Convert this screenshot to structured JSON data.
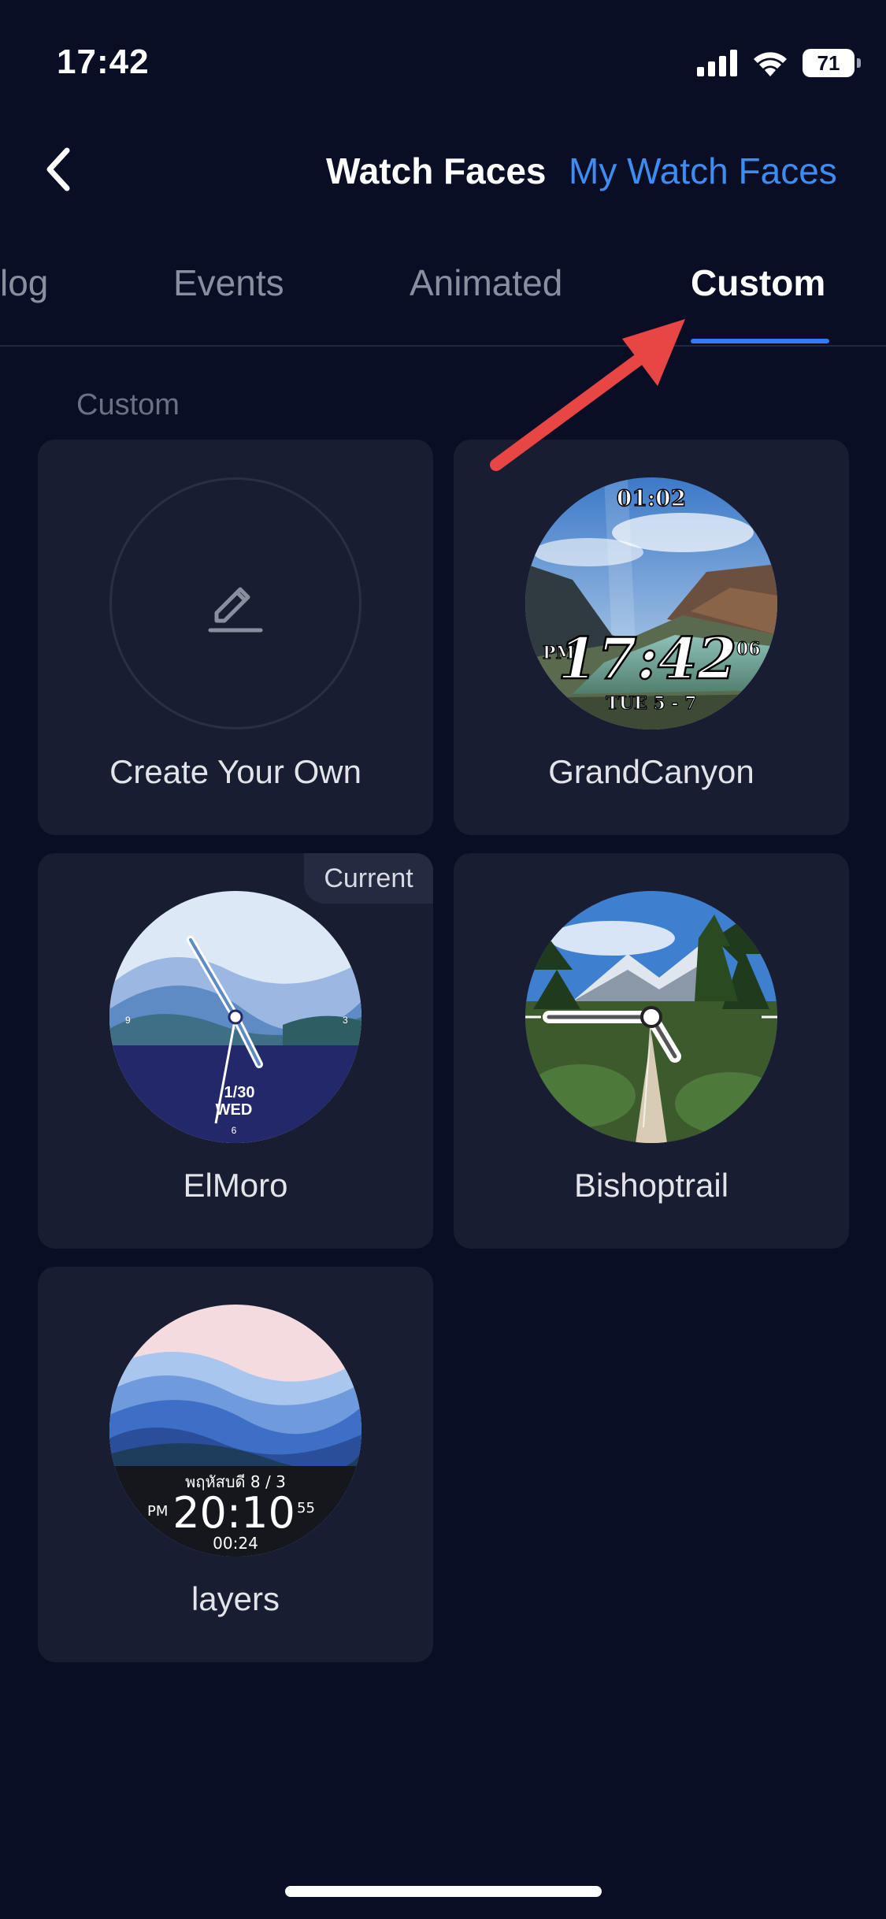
{
  "status_bar": {
    "time": "17:42",
    "battery": "71",
    "icons": [
      "cellular-signal-icon",
      "wifi-icon",
      "battery-icon"
    ]
  },
  "header": {
    "title": "Watch Faces",
    "link_label": "My Watch Faces",
    "back_icon": "chevron-left-icon"
  },
  "tabs": [
    {
      "label": "log"
    },
    {
      "label": "Events"
    },
    {
      "label": "Animated"
    },
    {
      "label": "Custom",
      "active": true
    }
  ],
  "section": {
    "title": "Custom"
  },
  "cards": {
    "create": {
      "label": "Create Your Own",
      "icon": "pencil-edit-icon"
    },
    "grandcanyon": {
      "label": "GrandCanyon",
      "face": {
        "top": "01:02",
        "ampm": "PM",
        "time": "17:42",
        "seconds": "06",
        "date": "TUE 5 - 7"
      }
    },
    "elmoro": {
      "label": "ElMoro",
      "badge": "Current",
      "face": {
        "date": "1/30",
        "day": "WED",
        "n9": "9",
        "n3": "3",
        "n6": "6"
      }
    },
    "bishoptrail": {
      "label": "Bishoptrail"
    },
    "layers": {
      "label": "layers",
      "face": {
        "date_line": "พฤหัสบดี 8 / 3",
        "ampm": "PM",
        "time": "20:10",
        "seconds": "55",
        "sub": "00:24"
      }
    }
  },
  "colors": {
    "background": "#090e25",
    "card": "#181d31",
    "accent": "#3f8cf0",
    "arrow": "#e84545"
  }
}
